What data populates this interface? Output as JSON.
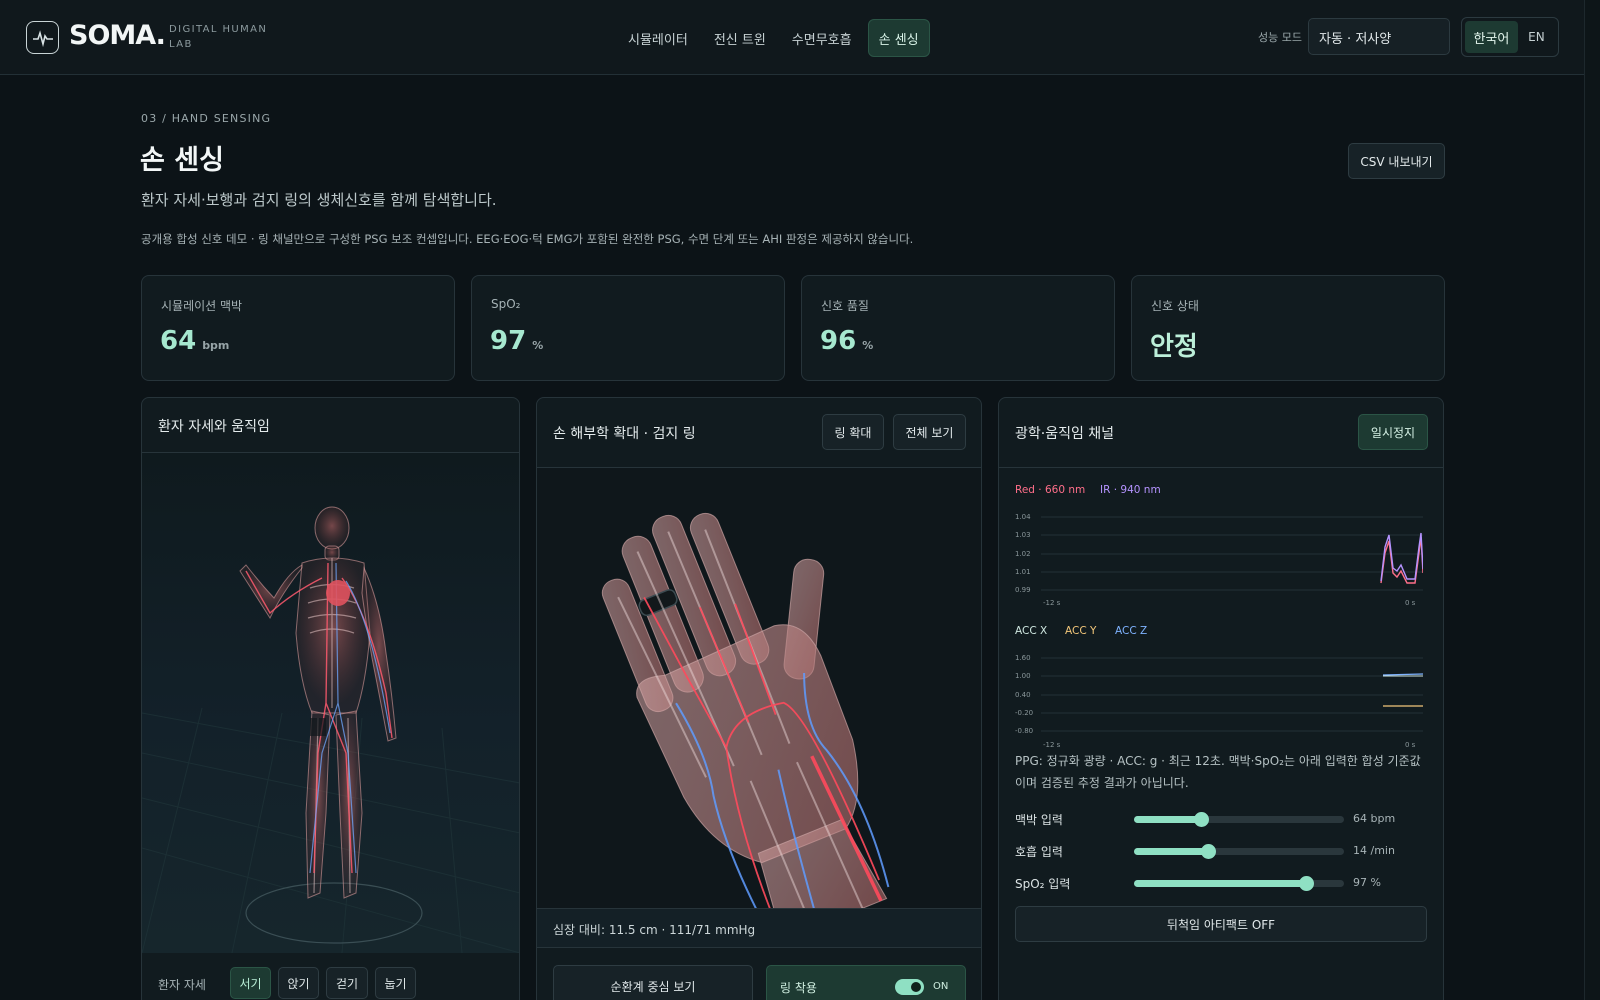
{
  "header": {
    "logo": "SOMA.",
    "logo_sub": "DIGITAL HUMAN LAB",
    "nav": [
      "시뮬레이터",
      "전신 트윈",
      "수면무호흡",
      "손 센싱"
    ],
    "perf_label": "성능 모드",
    "perf_value": "자동 · 저사양",
    "lang_ko": "한국어",
    "lang_en": "EN"
  },
  "page": {
    "eyebrow": "03 / HAND SENSING",
    "title": "손 센싱",
    "subtitle": "환자 자세·보행과 검지 링의 생체신호를 함께 탐색합니다.",
    "note": "공개용 합성 신호 데모 · 링 채널만으로 구성한 PSG 보조 컨셉입니다. EEG·EOG·턱 EMG가 포함된 완전한 PSG, 수면 단계 또는 AHI 판정은 제공하지 않습니다.",
    "csv_button": "CSV 내보내기"
  },
  "stats": [
    {
      "label": "시뮬레이션 맥박",
      "value": "64",
      "unit": "bpm"
    },
    {
      "label": "SpO₂",
      "value": "97",
      "unit": "%"
    },
    {
      "label": "신호 품질",
      "value": "96",
      "unit": "%"
    },
    {
      "label": "신호 상태",
      "value": "안정",
      "unit": ""
    }
  ],
  "body_panel": {
    "title": "환자 자세와 움직임",
    "posture_label": "환자 자세",
    "postures": [
      "서기",
      "앉기",
      "걷기",
      "눕기"
    ]
  },
  "hand_panel": {
    "title": "손 해부학 확대 · 검지 링",
    "zoom_ring": "링 확대",
    "full_view": "전체 보기",
    "footer": "심장 대비: 11.5 cm · 111/71 mmHg",
    "circ_button": "순환계 중심 보기",
    "ring_label": "링 착용",
    "ring_state": "ON"
  },
  "signal_panel": {
    "title": "광학·움직임 채널",
    "pause": "일시정지",
    "ppg_legend": {
      "red": "Red · 660 nm",
      "ir": "IR · 940 nm"
    },
    "acc_legend": {
      "x": "ACC X",
      "y": "ACC Y",
      "z": "ACC Z"
    },
    "ppg_yticks": [
      "1.04",
      "1.03",
      "1.02",
      "1.01",
      "0.99"
    ],
    "acc_yticks": [
      "1.60",
      "1.00",
      "0.40",
      "-0.20",
      "-0.80"
    ],
    "x_start": "-12 s",
    "x_end": "0 s",
    "note": "PPG: 정규화 광량 · ACC: g · 최근 12초. 맥박·SpO₂는 아래 입력한 합성 기준값이며 검증된 추정 결과가 아닙니다.",
    "sliders": [
      {
        "label": "맥박 입력",
        "value": "64 bpm",
        "fraction": 0.32
      },
      {
        "label": "호흡 입력",
        "value": "14 /min",
        "fraction": 0.35
      },
      {
        "label": "SpO₂ 입력",
        "value": "97 %",
        "fraction": 0.82
      }
    ],
    "artifact_button": "뒤척임 아티팩트 OFF"
  },
  "colors": {
    "accent": "#8fe0c3",
    "red_series": "#ff6f8a",
    "ir_series": "#b593ff",
    "acc_x": "#cfe7e0",
    "acc_y": "#f3c77a",
    "acc_z": "#7fb3ff"
  }
}
